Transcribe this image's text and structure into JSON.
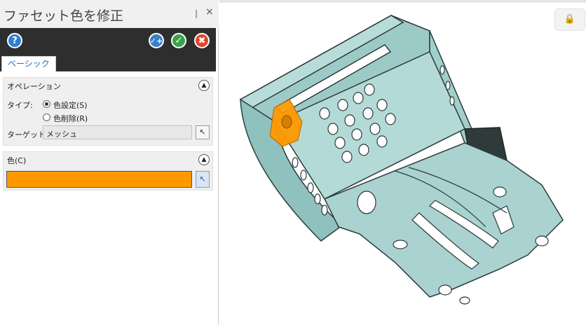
{
  "panel": {
    "title": "ファセット色を修正",
    "pin_glyph": "❘",
    "close_glyph": "×",
    "toolbar": {
      "help": "?",
      "apply": "✓+",
      "ok": "✓",
      "cancel": "✖"
    },
    "tab_label": "ベーシック",
    "operation": {
      "header": "オペレーション",
      "type_label": "タイプ:",
      "options": [
        "色設定(S)",
        "色削除(R)"
      ],
      "selected": "色設定(S)",
      "target_label": "ターゲット:",
      "target_value": "メッシュ"
    },
    "color": {
      "header": "色(C)",
      "value_hex": "#ff9900"
    }
  },
  "colors": {
    "model_body": "#a9d2d0",
    "model_edge": "#2d3a3a",
    "highlight": "#ff9900",
    "toolbar_bg": "#2e2e2e"
  },
  "icons": {
    "collapse": "▲",
    "pick": "↖"
  }
}
